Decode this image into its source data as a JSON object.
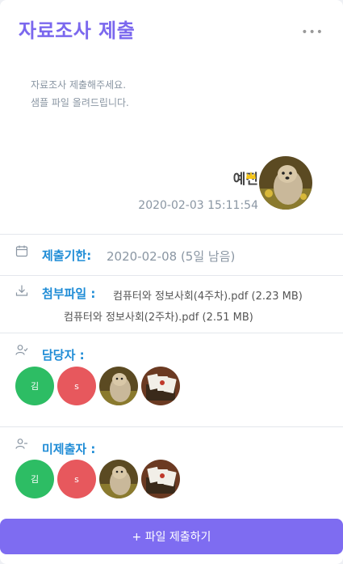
{
  "title": "자료조사 제출",
  "description": {
    "line1": "자료조사 제출해주세요.",
    "line2": "샘플 파일 올려드립니다."
  },
  "author": {
    "name": "예진",
    "date": "2020-02-03  15:11:54"
  },
  "deadline": {
    "label": "제출기한:",
    "value": "2020-02-08 (5일 남음)"
  },
  "attachments": {
    "label": "첨부파일 :",
    "files": [
      "컴퓨터와 정보사회(4주차).pdf (2.23 MB)",
      "컴퓨터와 정보사회(2주차).pdf (2.51 MB)"
    ]
  },
  "managers": {
    "label": "담당자 :",
    "initials": [
      "김",
      "s"
    ]
  },
  "non_submitters": {
    "label": "미제출자 :",
    "initials": [
      "김",
      "s"
    ]
  },
  "submit_button": "+ 파일 제출하기",
  "colors": {
    "accent": "#7b68ee",
    "label_blue": "#1f8cd6",
    "avatar_green": "#2dbd64",
    "avatar_red": "#e7585d"
  }
}
